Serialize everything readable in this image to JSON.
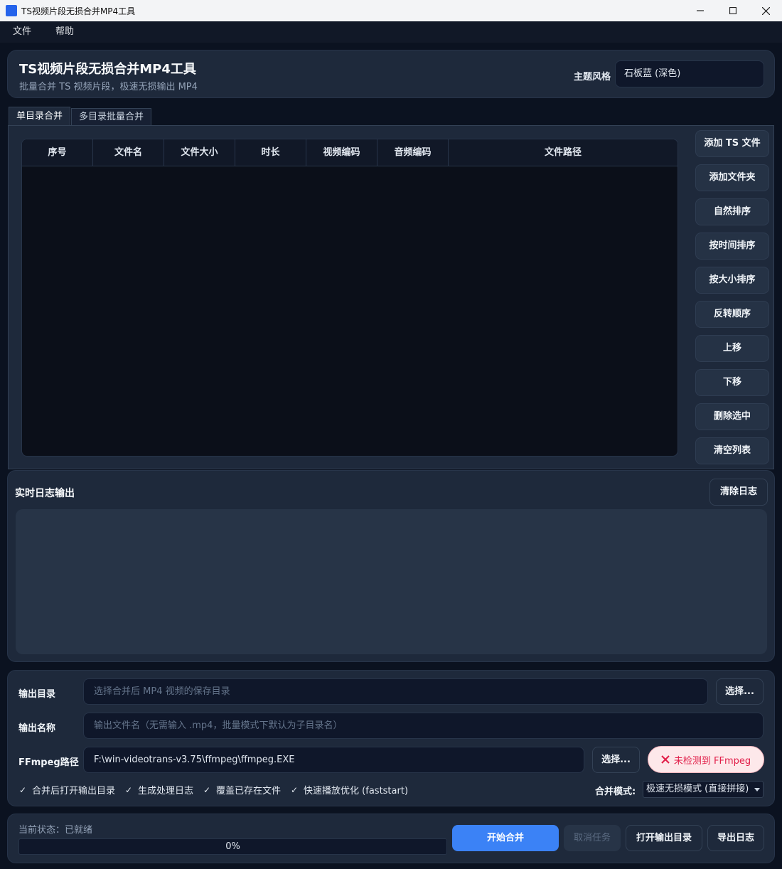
{
  "window": {
    "title": "TS视频片段无损合并MP4工具",
    "icon": "app-icon"
  },
  "menu": {
    "items": [
      "文件",
      "帮助"
    ]
  },
  "header": {
    "title": "TS视频片段无损合并MP4工具",
    "subtitle": "批量合并 TS 视频片段，极速无损输出 MP4",
    "theme_label": "主题风格",
    "theme_value": "石板蓝 (深色)"
  },
  "tabs": [
    {
      "label": "单目录合并",
      "active": true
    },
    {
      "label": "多目录批量合并",
      "active": false
    }
  ],
  "table": {
    "columns": [
      "序号",
      "文件名",
      "文件大小",
      "时长",
      "视频编码",
      "音频编码",
      "文件路径"
    ],
    "rows": []
  },
  "side_buttons": [
    "添加 TS 文件",
    "添加文件夹",
    "自然排序",
    "按时间排序",
    "按大小排序",
    "反转顺序",
    "上移",
    "下移",
    "删除选中",
    "清空列表"
  ],
  "log": {
    "title": "实时日志输出",
    "clear_label": "清除日志",
    "content": ""
  },
  "settings": {
    "output_dir_label": "输出目录",
    "output_dir_placeholder": "选择合并后 MP4 视频的保存目录",
    "output_dir_value": "",
    "select_label": "选择...",
    "output_name_label": "输出名称",
    "output_name_placeholder": "输出文件名（无需输入 .mp4，批量模式下默认为子目录名）",
    "output_name_value": "",
    "ffmpeg_label": "FFmpeg路径",
    "ffmpeg_value": "F:\\win-videotrans-v3.75\\ffmpeg\\ffmpeg.EXE",
    "ffmpeg_status": "未检测到 FFmpeg",
    "checkboxes": [
      {
        "label": "合并后打开输出目录",
        "checked": true
      },
      {
        "label": "生成处理日志",
        "checked": true
      },
      {
        "label": "覆盖已存在文件",
        "checked": true
      },
      {
        "label": "快速播放优化 (faststart)",
        "checked": true
      }
    ],
    "mode_label": "合并模式:",
    "mode_value": "极速无损模式 (直接拼接)"
  },
  "status": {
    "text": "当前状态：已就绪",
    "progress": "0%",
    "start_label": "开始合并",
    "cancel_label": "取消任务",
    "open_dir_label": "打开输出目录",
    "export_log_label": "导出日志"
  },
  "colors": {
    "accent": "#3b82f6",
    "error": "#e11d48",
    "background": "#0b1220",
    "card": "#1e293b"
  }
}
